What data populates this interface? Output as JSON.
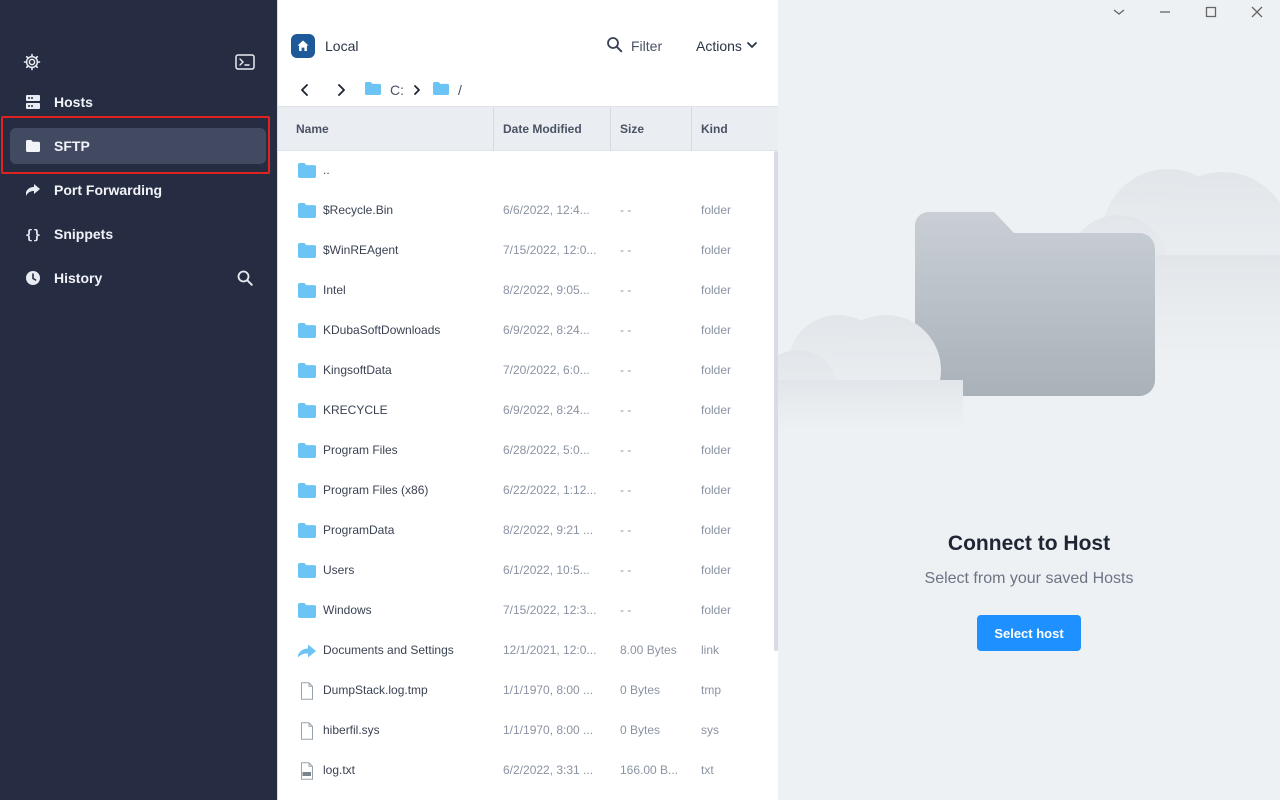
{
  "sidebar": {
    "top_icons": [
      "gear-icon",
      "terminal-icon"
    ],
    "items": [
      {
        "label": "Hosts",
        "icon": "hosts-icon",
        "active": false
      },
      {
        "label": "SFTP",
        "icon": "folder-icon",
        "active": true
      },
      {
        "label": "Port Forwarding",
        "icon": "port-forward-icon",
        "active": false
      },
      {
        "label": "Snippets",
        "icon": "braces-icon",
        "active": false
      },
      {
        "label": "History",
        "icon": "clock-icon",
        "active": false
      }
    ]
  },
  "panel": {
    "title": "Local",
    "filter_label": "Filter",
    "actions_label": "Actions",
    "path": [
      "C:",
      "/"
    ],
    "columns": {
      "name": "Name",
      "date": "Date Modified",
      "size": "Size",
      "kind": "Kind"
    },
    "files": [
      {
        "name": "..",
        "date": "",
        "size": "",
        "kind": "",
        "icon": "folder"
      },
      {
        "name": "$Recycle.Bin",
        "date": "6/6/2022, 12:4...",
        "size": "- -",
        "kind": "folder",
        "icon": "folder"
      },
      {
        "name": "$WinREAgent",
        "date": "7/15/2022, 12:0...",
        "size": "- -",
        "kind": "folder",
        "icon": "folder"
      },
      {
        "name": "Intel",
        "date": "8/2/2022, 9:05...",
        "size": "- -",
        "kind": "folder",
        "icon": "folder"
      },
      {
        "name": "KDubaSoftDownloads",
        "date": "6/9/2022, 8:24...",
        "size": "- -",
        "kind": "folder",
        "icon": "folder"
      },
      {
        "name": "KingsoftData",
        "date": "7/20/2022, 6:0...",
        "size": "- -",
        "kind": "folder",
        "icon": "folder"
      },
      {
        "name": "KRECYCLE",
        "date": "6/9/2022, 8:24...",
        "size": "- -",
        "kind": "folder",
        "icon": "folder"
      },
      {
        "name": "Program Files",
        "date": "6/28/2022, 5:0...",
        "size": "- -",
        "kind": "folder",
        "icon": "folder"
      },
      {
        "name": "Program Files (x86)",
        "date": "6/22/2022, 1:12...",
        "size": "- -",
        "kind": "folder",
        "icon": "folder"
      },
      {
        "name": "ProgramData",
        "date": "8/2/2022, 9:21 ...",
        "size": "- -",
        "kind": "folder",
        "icon": "folder"
      },
      {
        "name": "Users",
        "date": "6/1/2022, 10:5...",
        "size": "- -",
        "kind": "folder",
        "icon": "folder"
      },
      {
        "name": "Windows",
        "date": "7/15/2022, 12:3...",
        "size": "- -",
        "kind": "folder",
        "icon": "folder"
      },
      {
        "name": "Documents and Settings",
        "date": "12/1/2021, 12:0...",
        "size": "8.00 Bytes",
        "kind": "link",
        "icon": "link"
      },
      {
        "name": "DumpStack.log.tmp",
        "date": "1/1/1970, 8:00 ...",
        "size": "0 Bytes",
        "kind": "tmp",
        "icon": "file"
      },
      {
        "name": "hiberfil.sys",
        "date": "1/1/1970, 8:00 ...",
        "size": "0 Bytes",
        "kind": "sys",
        "icon": "file"
      },
      {
        "name": "log.txt",
        "date": "6/2/2022, 3:31 ...",
        "size": "166.00 B...",
        "kind": "txt",
        "icon": "txt-file"
      }
    ]
  },
  "right": {
    "title": "Connect to Host",
    "subtitle": "Select from your saved Hosts",
    "button_label": "Select host"
  },
  "colors": {
    "sidebar_bg": "#262d42",
    "sidebar_active": "#414a61",
    "highlight_border": "#e0231f",
    "folder_blue": "#6cc4f5",
    "primary_button": "#1e90ff"
  }
}
